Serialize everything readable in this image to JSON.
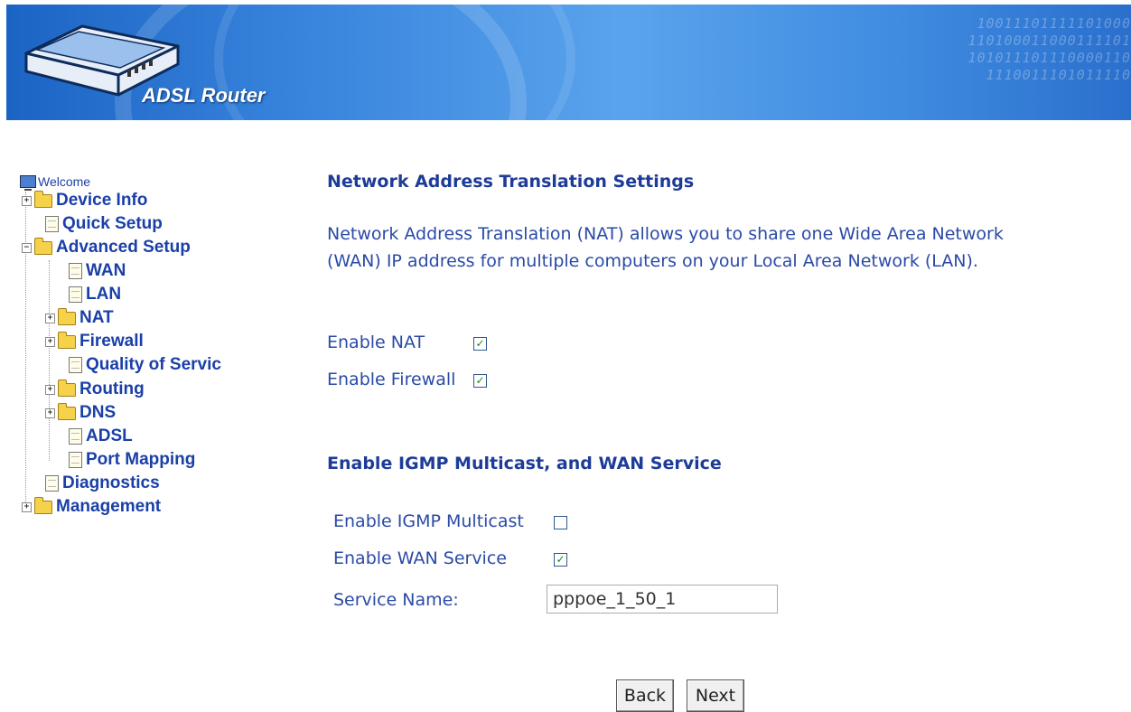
{
  "header": {
    "brand": "ADSL Router",
    "binary_lines": [
      "10011101111101000",
      "110100011000111101",
      "101011101110000110",
      "1110011101011110"
    ]
  },
  "sidebar": {
    "welcome": "Welcome",
    "items": [
      {
        "label": "Device Info"
      },
      {
        "label": "Quick Setup"
      },
      {
        "label": "Advanced Setup"
      },
      {
        "label": "WAN"
      },
      {
        "label": "LAN"
      },
      {
        "label": "NAT"
      },
      {
        "label": "Firewall"
      },
      {
        "label": "Quality of Servic"
      },
      {
        "label": "Routing"
      },
      {
        "label": "DNS"
      },
      {
        "label": "ADSL"
      },
      {
        "label": "Port Mapping"
      },
      {
        "label": "Diagnostics"
      },
      {
        "label": "Management"
      }
    ]
  },
  "main": {
    "title": "Network Address Translation Settings",
    "description": "Network Address Translation (NAT) allows you to share one Wide Area Network (WAN) IP address for multiple computers on your Local Area Network (LAN).",
    "enable_nat_label": "Enable NAT",
    "enable_nat_checked": true,
    "enable_firewall_label": "Enable Firewall",
    "enable_firewall_checked": true,
    "section2_title": "Enable IGMP Multicast, and WAN Service",
    "igmp_label": "Enable IGMP Multicast",
    "igmp_checked": false,
    "wan_service_label": "Enable WAN Service",
    "wan_service_checked": true,
    "service_name_label": "Service Name:",
    "service_name_value": "pppoe_1_50_1",
    "back_label": "Back",
    "next_label": "Next"
  },
  "colors": {
    "link_blue": "#1a3fa8",
    "text_blue": "#2a4aa6",
    "banner_blue": "#3a86de",
    "check_green": "#1b8a1b"
  }
}
